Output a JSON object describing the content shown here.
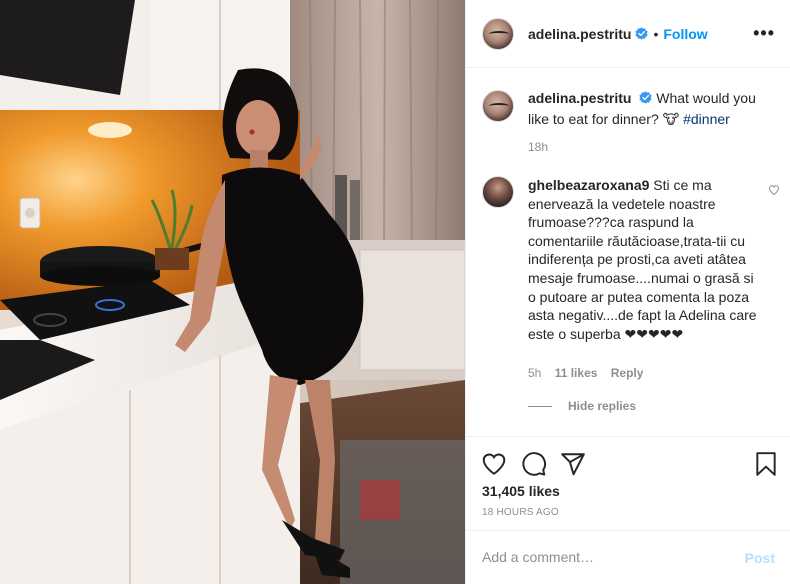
{
  "colors": {
    "link_blue": "#0095f6",
    "hashtag": "#00376b",
    "muted": "#8e8e8e",
    "post_disabled": "#b2dffc",
    "verified": "#3897f0"
  },
  "icons": {
    "verified": "verified-badge-icon",
    "more": "more-options-icon",
    "like": "heart-icon",
    "comment": "comment-icon",
    "share": "paper-plane-icon",
    "save": "bookmark-icon",
    "comment_like": "small-heart-icon"
  },
  "header": {
    "username": "adelina.pestritu",
    "dot": "•",
    "follow_label": "Follow",
    "more_label": "•••"
  },
  "caption": {
    "username": "adelina.pestritu",
    "text": "What would you like to eat for dinner?",
    "emoji": "🐮",
    "hashtag": "#dinner",
    "time": "18h"
  },
  "comment": {
    "username": "ghelbeazaroxana9",
    "text": "Sti ce ma enervează la vedetele noastre frumoase???ca raspund la comentariile răutăcioase,trata-tii cu indiferența pe prosti,ca aveti atâtea mesaje frumoase....numai o grasă si o putoare ar putea comenta la poza asta negativ....de fapt la Adelina care este o superba",
    "hearts": "❤❤❤❤❤",
    "time": "5h",
    "likes": "11 likes",
    "reply_label": "Reply",
    "hide_replies_label": "Hide replies"
  },
  "stats": {
    "likes": "31,405 likes",
    "posted": "18 HOURS AGO"
  },
  "add_comment": {
    "placeholder": "Add a comment…",
    "post_label": "Post"
  }
}
